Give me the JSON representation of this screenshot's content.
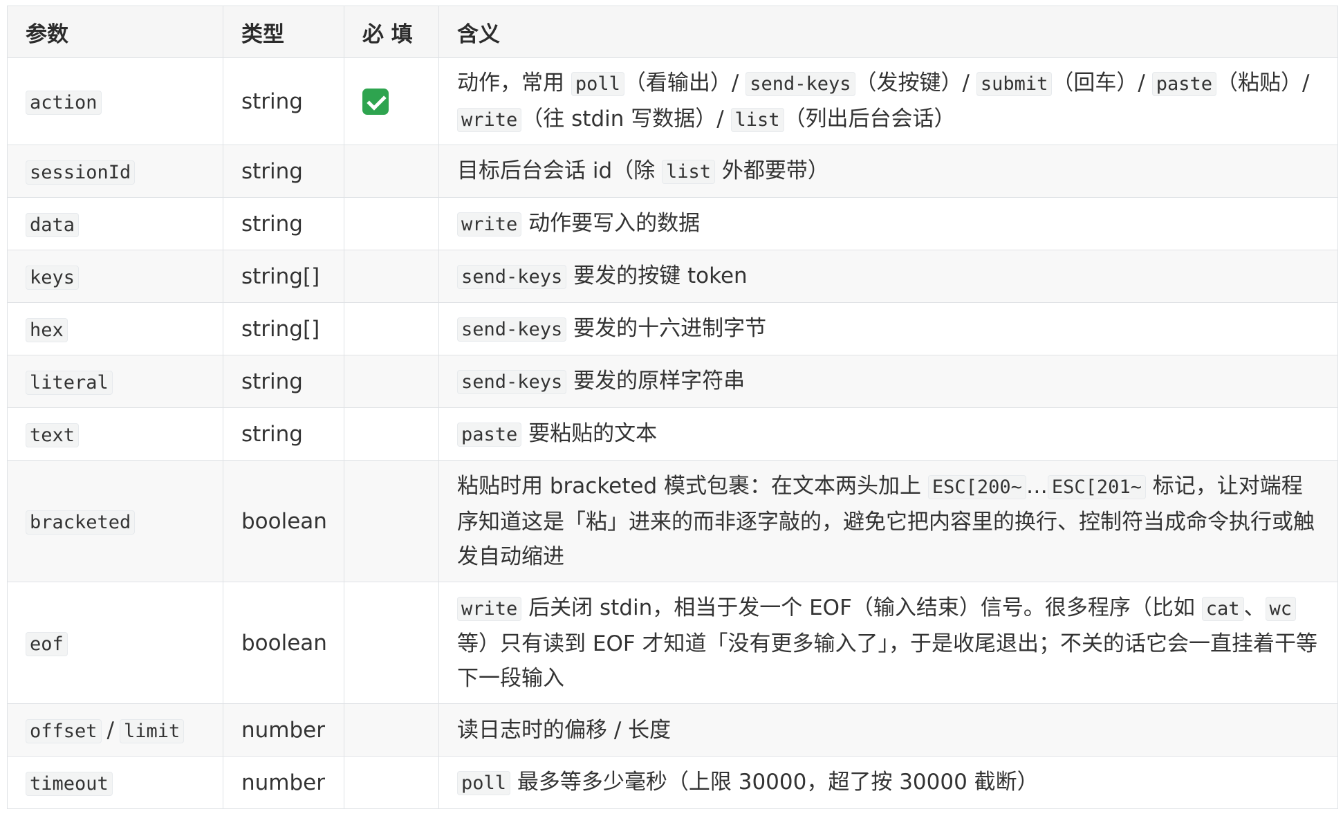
{
  "headers": {
    "param": "参数",
    "type": "类型",
    "required": "必 填",
    "meaning": "含义"
  },
  "colors": {
    "required_check": "#2ea44f",
    "border": "#dfe2e5",
    "code_bg": "#f3f4f4"
  },
  "rows": [
    {
      "params": [
        "action"
      ],
      "type": "string",
      "required": true,
      "required_icon": "check-mark-icon",
      "desc": [
        {
          "t": "text",
          "v": "动作，常用 "
        },
        {
          "t": "code",
          "v": "poll"
        },
        {
          "t": "text",
          "v": "（看输出）/ "
        },
        {
          "t": "code",
          "v": "send-keys"
        },
        {
          "t": "text",
          "v": "（发按键）/ "
        },
        {
          "t": "code",
          "v": "submit"
        },
        {
          "t": "text",
          "v": "（回车）/ "
        },
        {
          "t": "code",
          "v": "paste"
        },
        {
          "t": "text",
          "v": "（粘贴）/ "
        },
        {
          "t": "code",
          "v": "write"
        },
        {
          "t": "text",
          "v": "（往 stdin 写数据）/ "
        },
        {
          "t": "code",
          "v": "list"
        },
        {
          "t": "text",
          "v": "（列出后台会话）"
        }
      ]
    },
    {
      "params": [
        "sessionId"
      ],
      "type": "string",
      "required": false,
      "desc": [
        {
          "t": "text",
          "v": "目标后台会话 id（除 "
        },
        {
          "t": "code",
          "v": "list"
        },
        {
          "t": "text",
          "v": " 外都要带）"
        }
      ]
    },
    {
      "params": [
        "data"
      ],
      "type": "string",
      "required": false,
      "desc": [
        {
          "t": "code",
          "v": "write"
        },
        {
          "t": "text",
          "v": " 动作要写入的数据"
        }
      ]
    },
    {
      "params": [
        "keys"
      ],
      "type": "string[]",
      "required": false,
      "desc": [
        {
          "t": "code",
          "v": "send-keys"
        },
        {
          "t": "text",
          "v": " 要发的按键 token"
        }
      ]
    },
    {
      "params": [
        "hex"
      ],
      "type": "string[]",
      "required": false,
      "desc": [
        {
          "t": "code",
          "v": "send-keys"
        },
        {
          "t": "text",
          "v": " 要发的十六进制字节"
        }
      ]
    },
    {
      "params": [
        "literal"
      ],
      "type": "string",
      "required": false,
      "desc": [
        {
          "t": "code",
          "v": "send-keys"
        },
        {
          "t": "text",
          "v": " 要发的原样字符串"
        }
      ]
    },
    {
      "params": [
        "text"
      ],
      "type": "string",
      "required": false,
      "desc": [
        {
          "t": "code",
          "v": "paste"
        },
        {
          "t": "text",
          "v": " 要粘贴的文本"
        }
      ]
    },
    {
      "params": [
        "bracketed"
      ],
      "type": "boolean",
      "required": false,
      "desc": [
        {
          "t": "text",
          "v": "粘贴时用 bracketed 模式包裹：在文本两头加上 "
        },
        {
          "t": "code",
          "v": "ESC[200~"
        },
        {
          "t": "text",
          "v": "…"
        },
        {
          "t": "code",
          "v": "ESC[201~"
        },
        {
          "t": "text",
          "v": " 标记，让对端程序知道这是「粘」进来的而非逐字敲的，避免它把内容里的换行、控制符当成命令执行或触发自动缩进"
        }
      ]
    },
    {
      "params": [
        "eof"
      ],
      "type": "boolean",
      "required": false,
      "desc": [
        {
          "t": "code",
          "v": "write"
        },
        {
          "t": "text",
          "v": " 后关闭 stdin，相当于发一个 EOF（输入结束）信号。很多程序（比如 "
        },
        {
          "t": "code",
          "v": "cat"
        },
        {
          "t": "text",
          "v": "、"
        },
        {
          "t": "code",
          "v": "wc"
        },
        {
          "t": "text",
          "v": " 等）只有读到 EOF 才知道「没有更多输入了」，于是收尾退出；不关的话它会一直挂着干等下一段输入"
        }
      ]
    },
    {
      "params": [
        "offset",
        "limit"
      ],
      "param_separator": "/",
      "type": "number",
      "required": false,
      "desc": [
        {
          "t": "text",
          "v": "读日志时的偏移 / 长度"
        }
      ]
    },
    {
      "params": [
        "timeout"
      ],
      "type": "number",
      "required": false,
      "desc": [
        {
          "t": "code",
          "v": "poll"
        },
        {
          "t": "text",
          "v": " 最多等多少毫秒（上限 30000，超了按 30000 截断）"
        }
      ]
    }
  ]
}
